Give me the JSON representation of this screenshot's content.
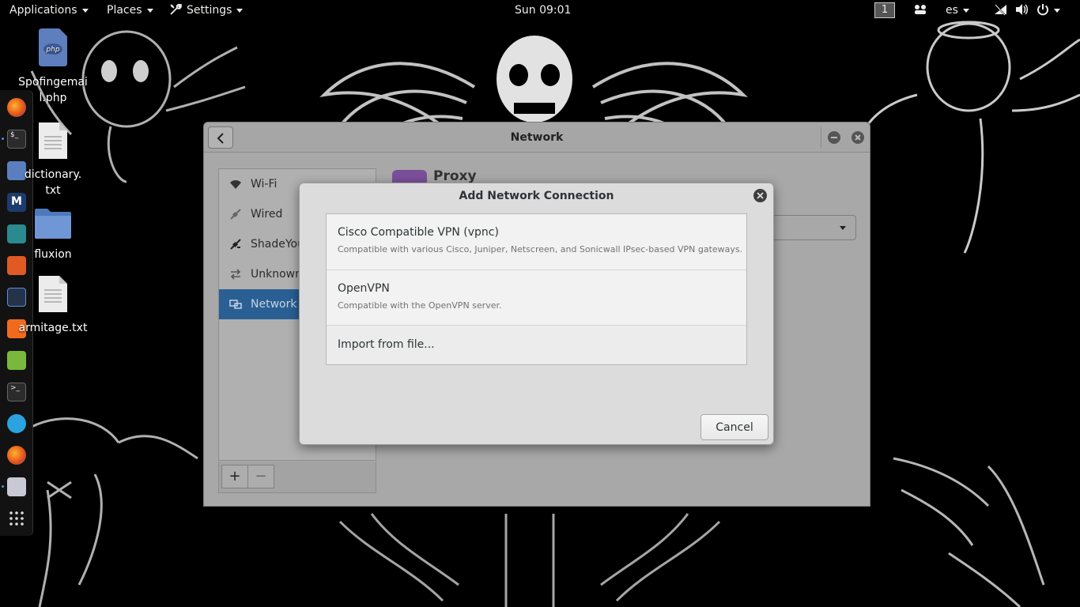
{
  "topbar": {
    "applications": "Applications",
    "places": "Places",
    "settings": "Settings",
    "clock": "Sun 09:01",
    "workspace": "1",
    "keyboard_layout": "es"
  },
  "desktop": {
    "icons": [
      {
        "label": "Spofingemai l.php",
        "icon": "php-file-icon"
      },
      {
        "label": "dictionary. txt",
        "icon": "text-file-icon"
      },
      {
        "label": "fluxion",
        "icon": "folder-icon"
      },
      {
        "label": "armitage.txt",
        "icon": "text-file-icon"
      }
    ]
  },
  "dock": {
    "apps": [
      "firefox-icon",
      "terminal-icon",
      "files-icon",
      "maltego-icon",
      "app-icon",
      "burpsuite-icon",
      "app-icon",
      "faraday-icon",
      "notes-icon",
      "terminal-icon",
      "telegram-icon",
      "firefox-icon",
      "tweaks-icon",
      "show-apps-icon"
    ]
  },
  "network_window": {
    "title": "Network",
    "sidebar": [
      {
        "label": "Wi-Fi",
        "icon": "wifi-icon",
        "active": false
      },
      {
        "label": "Wired",
        "icon": "wired-icon",
        "active": false
      },
      {
        "label": "ShadeYou",
        "icon": "vpn-icon",
        "active": false
      },
      {
        "label": "Unknown",
        "icon": "arrows-icon",
        "active": false
      },
      {
        "label": "Network p",
        "icon": "network-proxy-icon",
        "active": true
      }
    ],
    "add_label": "+",
    "remove_label": "−",
    "panel_title": "Proxy"
  },
  "dialog": {
    "title": "Add Network Connection",
    "connections": [
      {
        "name": "Cisco Compatible VPN (vpnc)",
        "description": "Compatible with various Cisco, Juniper, Netscreen, and Sonicwall IPsec-based VPN gateways."
      },
      {
        "name": "OpenVPN",
        "description": "Compatible with the OpenVPN server."
      }
    ],
    "import_label": "Import from file...",
    "cancel_label": "Cancel"
  },
  "colors": {
    "selection": "#2a5f94",
    "dialog_bg": "#dcdcdc",
    "window_bg": "#a8a8a8"
  }
}
